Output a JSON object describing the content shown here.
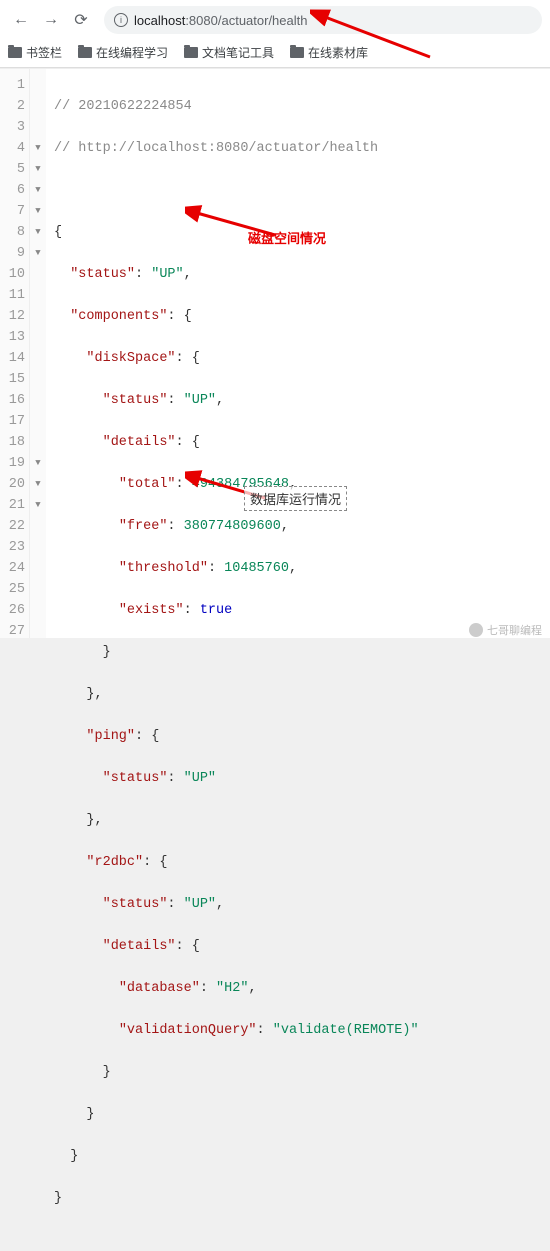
{
  "browser": {
    "url_host": "localhost",
    "url_port": ":8080",
    "url_path": "/actuator/health"
  },
  "bookmarks": [
    "书签栏",
    "在线编程学习",
    "文档笔记工具",
    "在线素材库"
  ],
  "annotations": {
    "disk": "磁盘空间情况",
    "db": "数据库运行情况"
  },
  "watermark": "七哥聊编程",
  "code": {
    "comment1": "// 20210622224854",
    "comment2": "// http://localhost:8080/actuator/health",
    "line4": "{",
    "line5_k": "\"status\"",
    "line5_v": "\"UP\"",
    "line6_k": "\"components\"",
    "line7_k": "\"diskSpace\"",
    "line8_k": "\"status\"",
    "line8_v": "\"UP\"",
    "line9_k": "\"details\"",
    "line10_k": "\"total\"",
    "line10_v": "494384795648",
    "line11_k": "\"free\"",
    "line11_v": "380774809600",
    "line12_k": "\"threshold\"",
    "line12_v": "10485760",
    "line13_k": "\"exists\"",
    "line13_v": "true",
    "line16_k": "\"ping\"",
    "line17_k": "\"status\"",
    "line17_v": "\"UP\"",
    "line19_k": "\"r2dbc\"",
    "line20_k": "\"status\"",
    "line20_v": "\"UP\"",
    "line21_k": "\"details\"",
    "line22_k": "\"database\"",
    "line22_v": "\"H2\"",
    "line23_k": "\"validationQuery\"",
    "line23_v": "\"validate(REMOTE)\""
  },
  "fold_rows": [
    4,
    5,
    6,
    7,
    8,
    9,
    19,
    20,
    21
  ]
}
